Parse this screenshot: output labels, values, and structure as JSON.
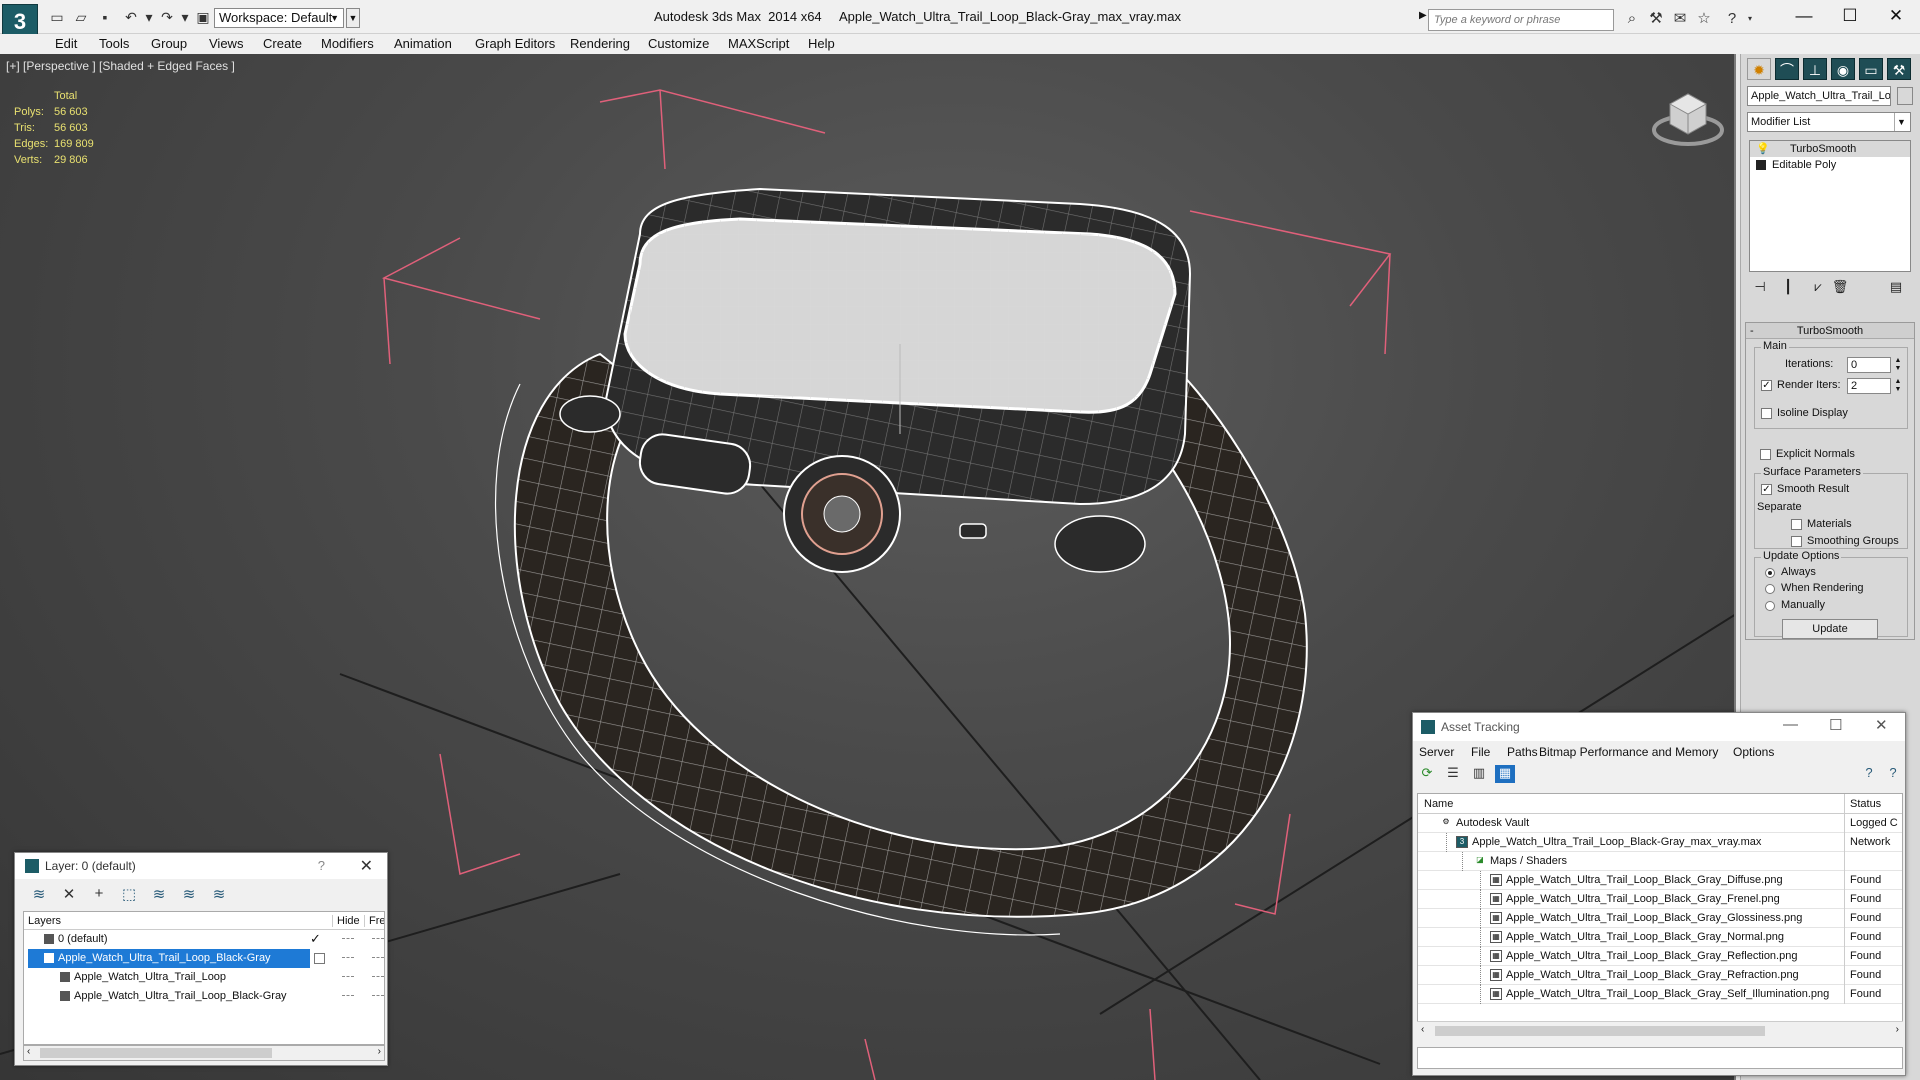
{
  "titlebar": {
    "workspace_label": "Workspace: Default",
    "app_title": "Autodesk 3ds Max  2014 x64     Apple_Watch_Ultra_Trail_Loop_Black-Gray_max_vray.max",
    "search_placeholder": "Type a keyword or phrase"
  },
  "menus": [
    "Edit",
    "Tools",
    "Group",
    "Views",
    "Create",
    "Modifiers",
    "Animation",
    "Graph Editors",
    "Rendering",
    "Customize",
    "MAXScript",
    "Help"
  ],
  "viewport": {
    "label": "[+] [Perspective ] [Shaded + Edged Faces ]",
    "stats_header": "Total",
    "stats": [
      {
        "label": "Polys:",
        "value": "56 603"
      },
      {
        "label": "Tris:",
        "value": "56 603"
      },
      {
        "label": "Edges:",
        "value": "169 809"
      },
      {
        "label": "Verts:",
        "value": "29 806"
      }
    ]
  },
  "cmdpanel": {
    "object_name": "Apple_Watch_Ultra_Trail_Loop_Black-Gray",
    "modifier_list": "Modifier List",
    "stack": [
      "TurboSmooth",
      "Editable Poly"
    ],
    "rollout_title": "TurboSmooth",
    "main_label": "Main",
    "iterations_label": "Iterations:",
    "iterations_value": "0",
    "render_iters_label": "Render Iters:",
    "render_iters_value": "2",
    "isoline_label": "Isoline Display",
    "explicit_label": "Explicit Normals",
    "surface_label": "Surface Parameters",
    "smooth_label": "Smooth Result",
    "separate_label": "Separate",
    "materials_label": "Materials",
    "smoothing_label": "Smoothing Groups",
    "update_options_label": "Update Options",
    "always_label": "Always",
    "when_rendering_label": "When Rendering",
    "manually_label": "Manually",
    "update_button": "Update"
  },
  "layer_dialog": {
    "title": "Layer: 0 (default)",
    "help": "?",
    "col_layers": "Layers",
    "col_hide": "Hide",
    "col_freeze": "Fre",
    "rows": [
      {
        "name": "0 (default)"
      },
      {
        "name": "Apple_Watch_Ultra_Trail_Loop_Black-Gray"
      },
      {
        "name": "Apple_Watch_Ultra_Trail_Loop"
      },
      {
        "name": "Apple_Watch_Ultra_Trail_Loop_Black-Gray"
      }
    ]
  },
  "asset_dialog": {
    "title": "Asset Tracking",
    "menus": [
      "Server",
      "File",
      "Paths",
      "Bitmap Performance and Memory",
      "Options"
    ],
    "col_name": "Name",
    "col_status": "Status",
    "rows": [
      {
        "name": "Autodesk Vault",
        "status": "Logged C"
      },
      {
        "name": "Apple_Watch_Ultra_Trail_Loop_Black-Gray_max_vray.max",
        "status": "Network"
      },
      {
        "name": "Maps / Shaders",
        "status": ""
      },
      {
        "name": "Apple_Watch_Ultra_Trail_Loop_Black_Gray_Diffuse.png",
        "status": "Found"
      },
      {
        "name": "Apple_Watch_Ultra_Trail_Loop_Black_Gray_Frenel.png",
        "status": "Found"
      },
      {
        "name": "Apple_Watch_Ultra_Trail_Loop_Black_Gray_Glossiness.png",
        "status": "Found"
      },
      {
        "name": "Apple_Watch_Ultra_Trail_Loop_Black_Gray_Normal.png",
        "status": "Found"
      },
      {
        "name": "Apple_Watch_Ultra_Trail_Loop_Black_Gray_Reflection.png",
        "status": "Found"
      },
      {
        "name": "Apple_Watch_Ultra_Trail_Loop_Black_Gray_Refraction.png",
        "status": "Found"
      },
      {
        "name": "Apple_Watch_Ultra_Trail_Loop_Black_Gray_Self_Illumination.png",
        "status": "Found"
      }
    ]
  },
  "colors": {
    "selection": "#1e7ad6",
    "stats_text": "#e8e070",
    "bbox_bracket": "#e0607a"
  }
}
